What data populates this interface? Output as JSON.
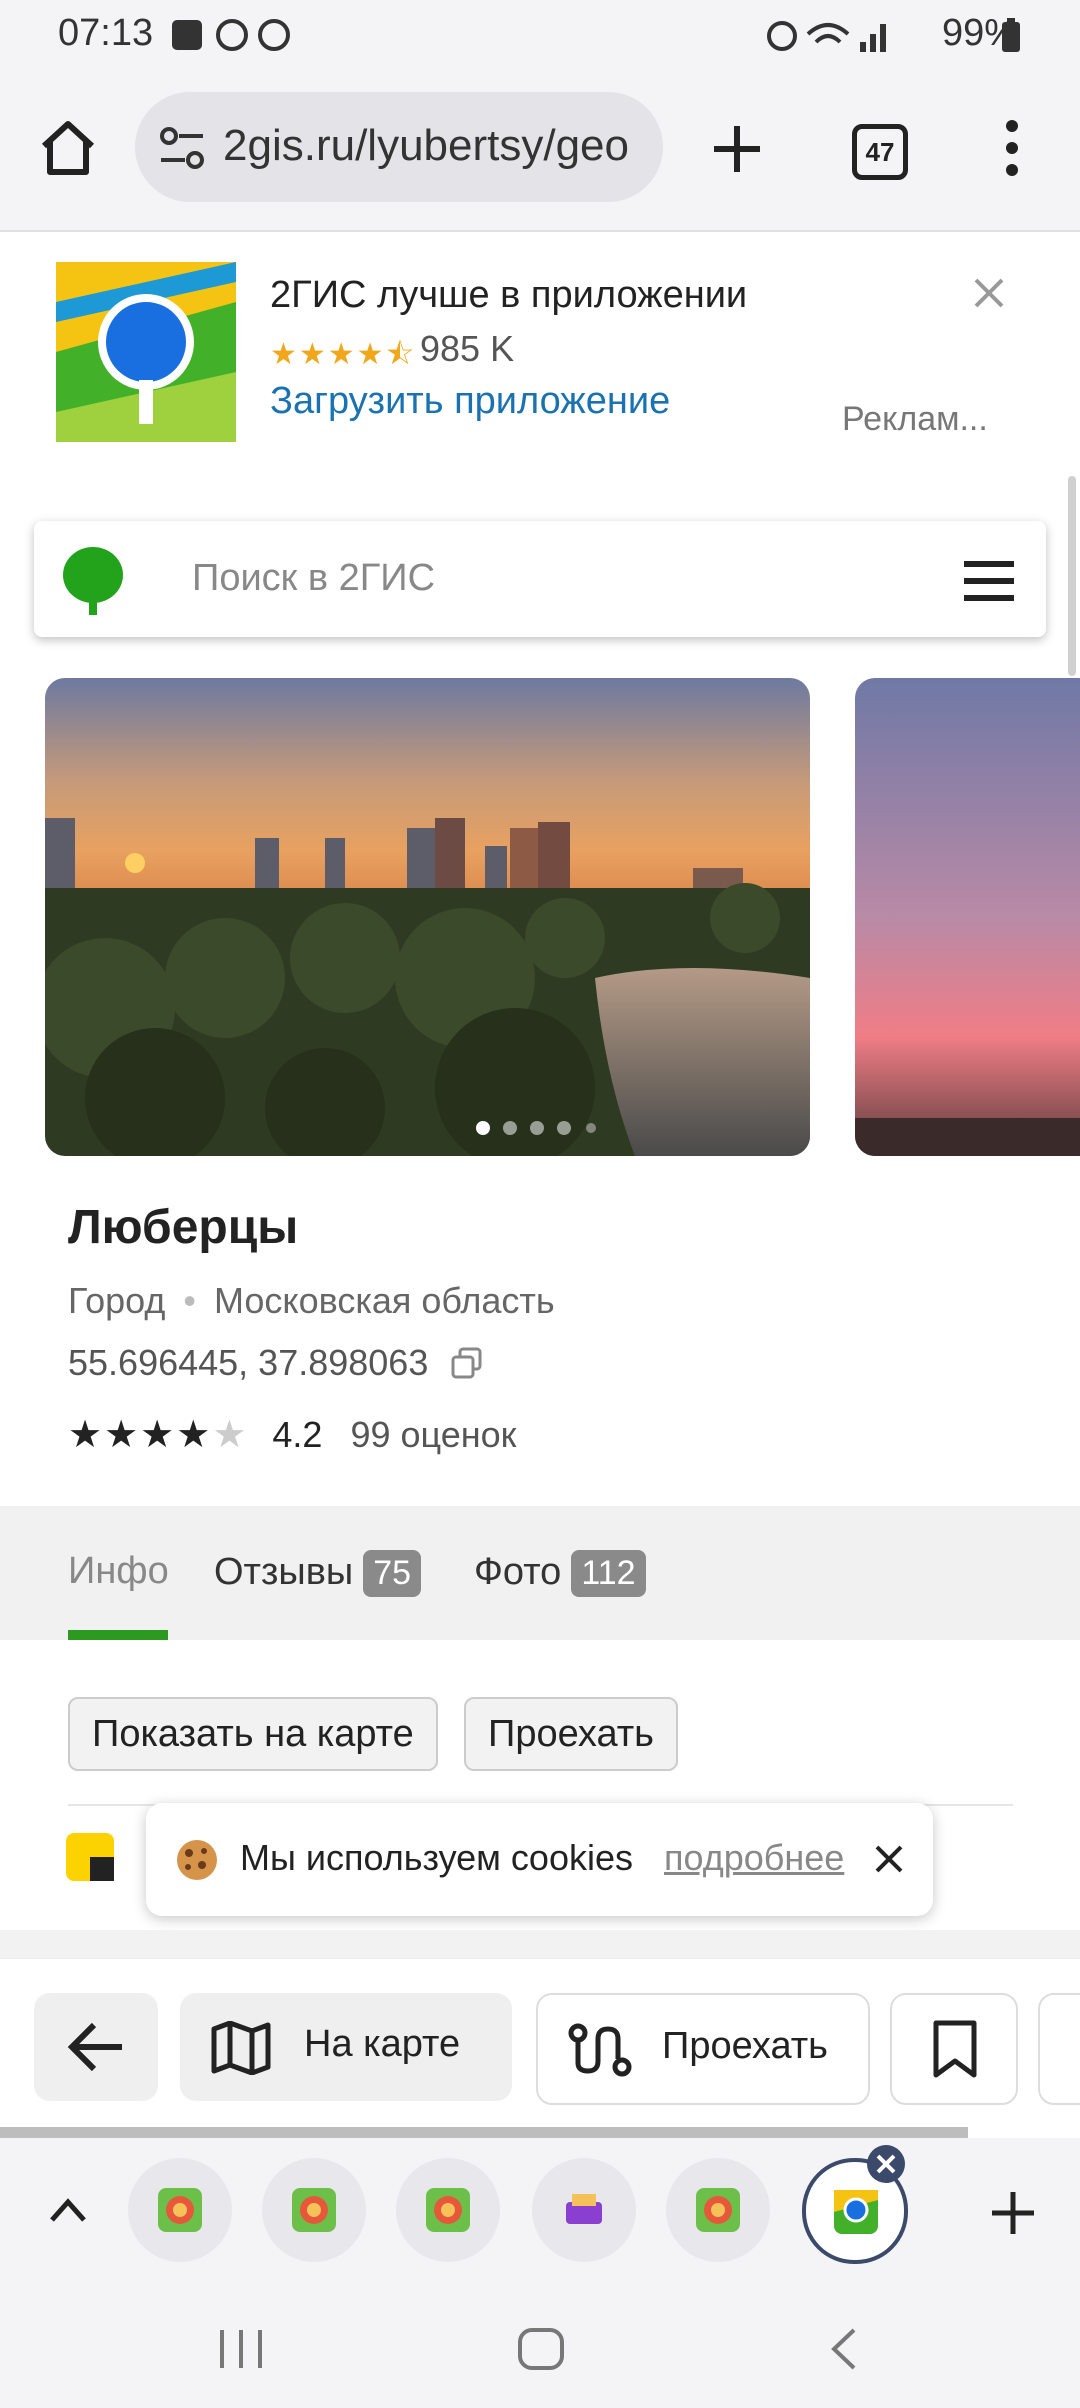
{
  "status": {
    "time": "07:13",
    "battery": "99%"
  },
  "browser": {
    "url": "2gis.ru/lyubertsy/geo",
    "tab_count": "47"
  },
  "ad": {
    "title": "2ГИС лучше в приложении",
    "rating_stars": "★★★★⯪",
    "reviews": "985 K",
    "install_label": "Загрузить приложение",
    "ad_label": "Реклам..."
  },
  "search": {
    "placeholder": "Поиск в 2ГИС"
  },
  "place": {
    "title": "Люберцы",
    "type": "Город",
    "region": "Московская область",
    "coords": "55.696445, 37.898063",
    "rating_value": "4.2",
    "rating_count": "99 оценок",
    "stars_filled": 4,
    "photo_page": 1,
    "photo_pages": 5
  },
  "tabs": {
    "info": "Инфо",
    "reviews": "Отзывы",
    "reviews_count": "75",
    "photos": "Фото",
    "photos_count": "112"
  },
  "actions": {
    "show_on_map": "Показать на карте",
    "route": "Проехать"
  },
  "cookie": {
    "text": "Мы используем cookies",
    "more": "подробнее"
  },
  "bottom_bar": {
    "on_map": "На карте",
    "route": "Проехать"
  },
  "colors": {
    "accent_green": "#2b9a1e",
    "link_blue": "#1a73b0",
    "star_orange": "#f1a71b"
  }
}
